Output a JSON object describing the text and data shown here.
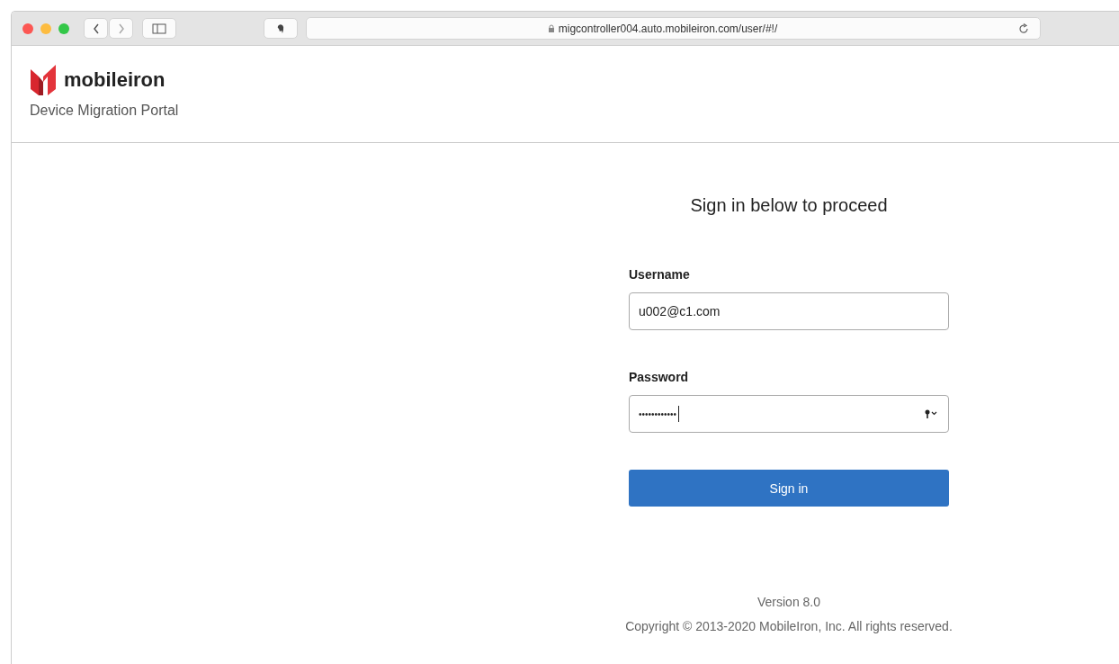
{
  "browser": {
    "url": "migcontroller004.auto.mobileiron.com/user/#!/"
  },
  "header": {
    "brand": "mobileiron",
    "subtitle": "Device Migration Portal"
  },
  "form": {
    "heading": "Sign in below to proceed",
    "username": {
      "label": "Username",
      "value": "u002@c1.com"
    },
    "password": {
      "label": "Password",
      "value": "••••••••••••"
    },
    "submit": "Sign in"
  },
  "footer": {
    "version": "Version 8.0",
    "copyright": "Copyright © 2013-2020 MobileIron, Inc. All rights reserved."
  }
}
